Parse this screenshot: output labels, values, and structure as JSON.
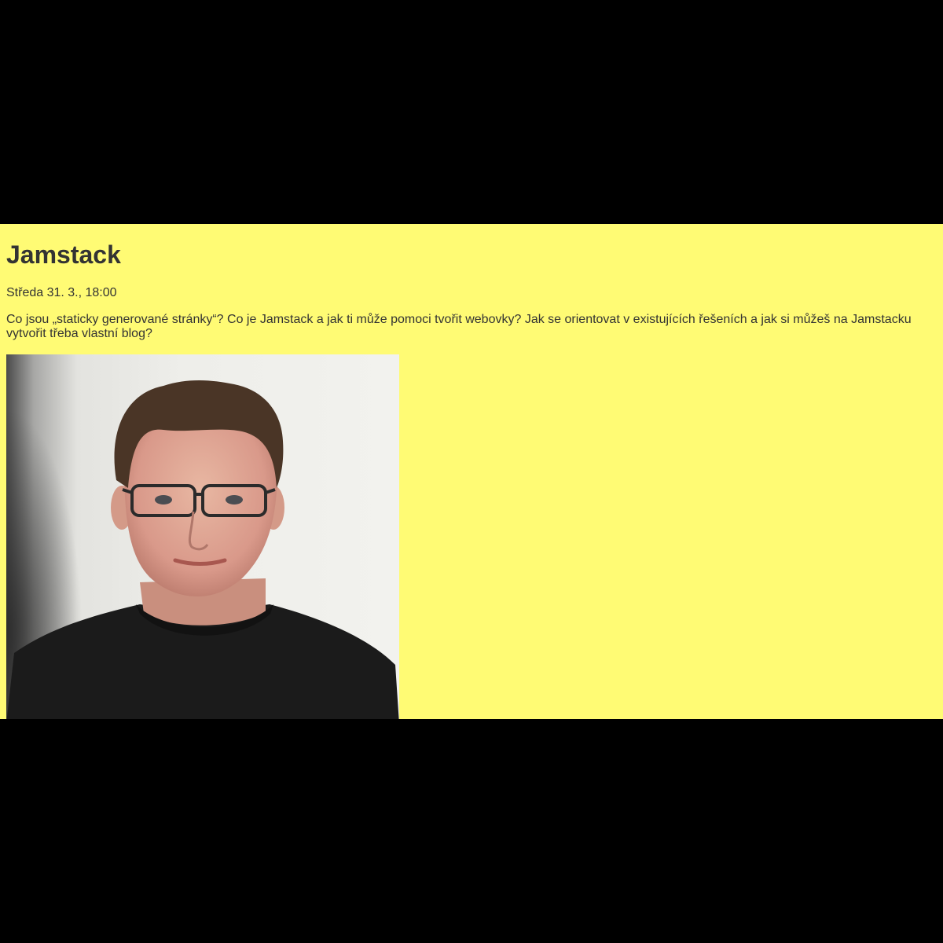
{
  "event": {
    "title": "Jamstack",
    "date": "Středa 31. 3., 18:00",
    "description": "Co jsou „staticky generované stránky“? Co je Jamstack a jak ti může pomoci tvořit webovky? Jak se orientovat v existujících řešeních a jak si můžeš na Jamstacku vytvořit třeba vlastní blog?"
  },
  "colors": {
    "background": "#000000",
    "panel": "#fffb74",
    "text": "#333333"
  }
}
